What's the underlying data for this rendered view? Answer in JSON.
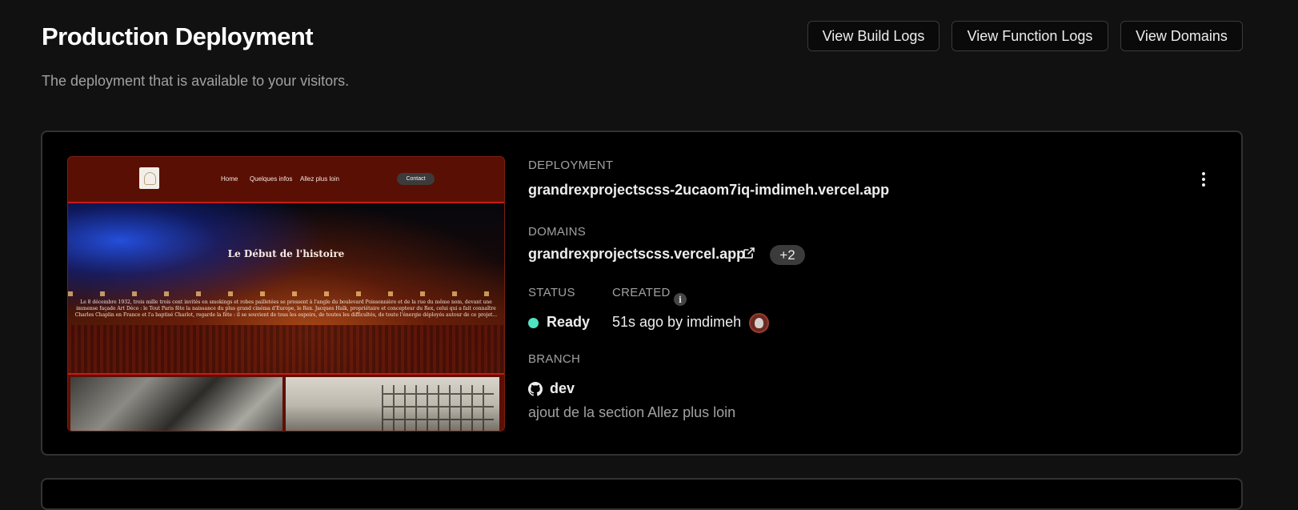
{
  "header": {
    "title": "Production Deployment",
    "subtitle": "The deployment that is available to your visitors.",
    "buttons": {
      "build_logs": "View Build Logs",
      "function_logs": "View Function Logs",
      "domains": "View Domains"
    }
  },
  "preview": {
    "nav": {
      "links": [
        "Home",
        "Quelques infos",
        "Allez plus loin"
      ],
      "contact": "Contact"
    },
    "hero_title": "Le Début de l'histoire",
    "hero_text": "Le 8 décembre 1932, trois mille trois cent invités en smokings et robes pailletées se pressent à l'angle du boulevard Poissonnière et de la rue du même nom, devant une immense façade Art Déco : le Tout Paris fête la naissance du plus grand cinéma d'Europe, le Rex. Jacques Haïk, propriétaire et concepteur du Rex, celui qui a fait connaître Charles Chaplin en France et l'a baptisé Charlot, regarde la fête : il se souvient de tous les espoirs, de toutes les difficultés, de toute l'énergie déployés autour de ce projet..."
  },
  "deployment": {
    "label": "DEPLOYMENT",
    "url": "grandrexprojectscss-2ucaom7iq-imdimeh.vercel.app"
  },
  "domains": {
    "label": "DOMAINS",
    "primary": "grandrexprojectscss.vercel.app",
    "extra_count": "+2"
  },
  "status": {
    "label": "STATUS",
    "value": "Ready",
    "color": "#50e3c2"
  },
  "created": {
    "label": "CREATED",
    "value": "51s ago by imdimeh"
  },
  "branch": {
    "label": "BRANCH",
    "name": "dev",
    "commit_message": "ajout de la section Allez plus loin"
  },
  "icons": [
    "external-link-icon",
    "info-icon",
    "github-icon",
    "more-options-icon",
    "avatar"
  ]
}
